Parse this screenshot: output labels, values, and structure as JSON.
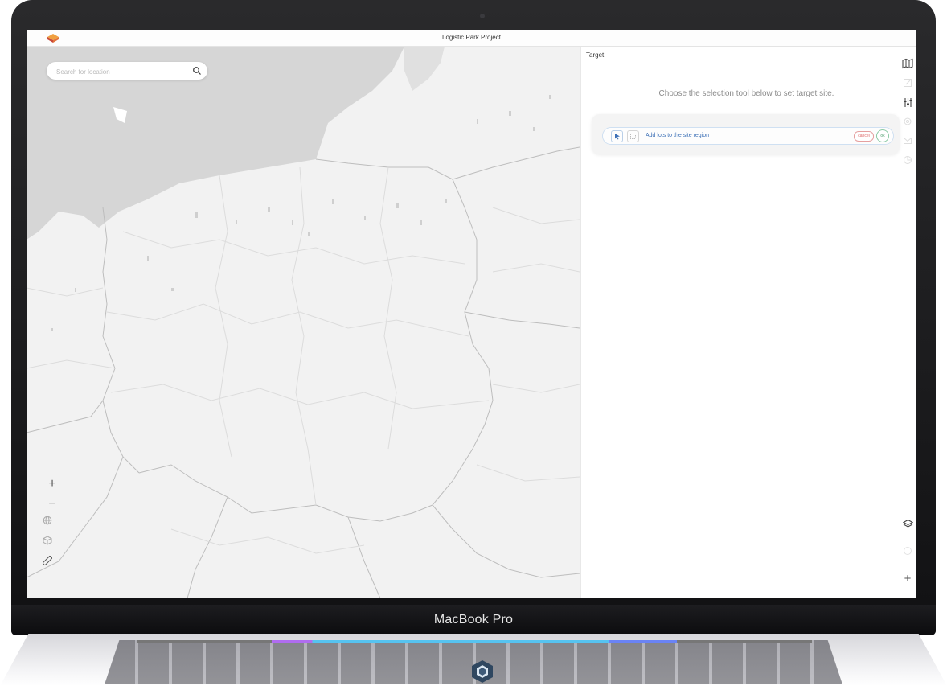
{
  "app": {
    "title": "Logistic Park Project"
  },
  "search": {
    "placeholder": "Search for location",
    "value": ""
  },
  "map_tools": {
    "zoom_in": "+",
    "zoom_out": "−"
  },
  "panel": {
    "label": "Target",
    "hint": "Choose the selection tool below to set target site.",
    "selection": {
      "instruction": "Add lots to the site region",
      "cancel_label": "cancel",
      "ok_label": "ok"
    }
  },
  "right_toolbar": {
    "bottom_add": "+"
  },
  "device": {
    "brand": "MacBook Pro"
  },
  "colors": {
    "accent_blue": "#3b6fb6",
    "cancel_red": "#d66666",
    "ok_green": "#4a9b6a",
    "sea_gray": "#d6d6d6",
    "land": "#f2f2f2"
  }
}
